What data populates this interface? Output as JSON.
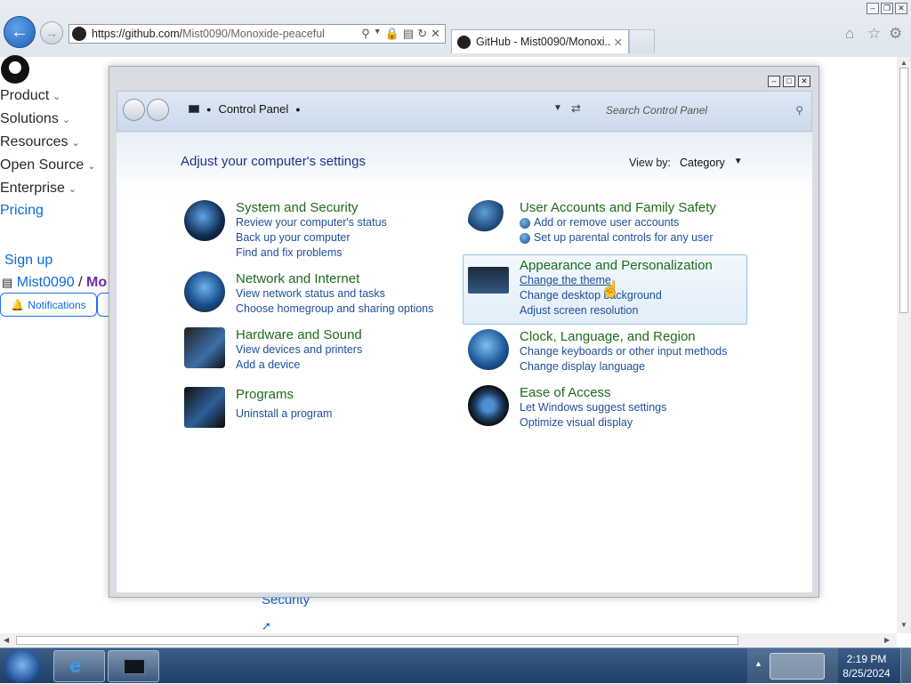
{
  "browser": {
    "url_host": "https://github.com/",
    "url_path": "Mist0090/Monoxide-peaceful",
    "tab_title": "GitHub - Mist0090/Monoxi...",
    "window_buttons": [
      "minimize",
      "restore",
      "close"
    ],
    "tools_icons": [
      "home-icon",
      "star-icon",
      "gear-icon"
    ]
  },
  "github": {
    "menu": [
      "Product",
      "Solutions",
      "Resources",
      "Open Source",
      "Enterprise"
    ],
    "pricing": "Pricing",
    "sign_up": "Sign up",
    "owner": "Mist0090",
    "separator": "/",
    "repo_partial": "Mo",
    "notifications": "Notifications",
    "security": "Security"
  },
  "control_panel": {
    "breadcrumb": "Control Panel",
    "search_placeholder": "Search Control Panel",
    "heading": "Adjust your computer's settings",
    "view_by_label": "View by:",
    "view_by_value": "Category",
    "categories": [
      {
        "title": "System and Security",
        "links": [
          "Review your computer's status",
          "Back up your computer",
          "Find and fix problems"
        ]
      },
      {
        "title": "Network and Internet",
        "links": [
          "View network status and tasks",
          "Choose homegroup and sharing options"
        ]
      },
      {
        "title": "Hardware and Sound",
        "links": [
          "View devices and printers",
          "Add a device"
        ]
      },
      {
        "title": "Programs",
        "links": [
          "Uninstall a program"
        ]
      },
      {
        "title": "User Accounts and Family Safety",
        "links": [
          "Add or remove user accounts",
          "Set up parental controls for any user"
        ]
      },
      {
        "title": "Appearance and Personalization",
        "links": [
          "Change the theme",
          "Change desktop background",
          "Adjust screen resolution"
        ]
      },
      {
        "title": "Clock, Language, and Region",
        "links": [
          "Change keyboards or other input methods",
          "Change display language"
        ]
      },
      {
        "title": "Ease of Access",
        "links": [
          "Let Windows suggest settings",
          "Optimize visual display"
        ]
      }
    ]
  },
  "taskbar": {
    "time": "2:19 PM",
    "date": "8/25/2024"
  },
  "colors": {
    "category_title": "#1d6b1d",
    "link": "#1e4f9a",
    "heading": "#1e3287",
    "github_link": "#0969da"
  }
}
